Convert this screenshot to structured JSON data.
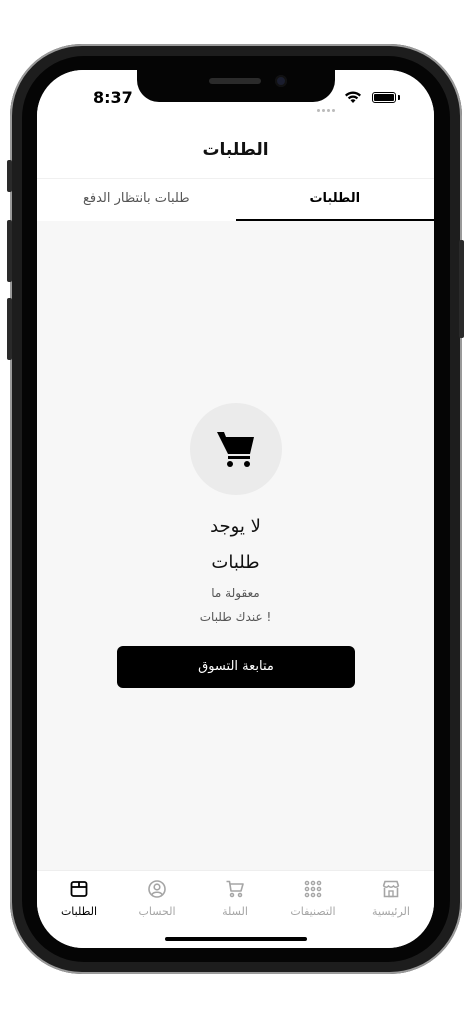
{
  "status_bar": {
    "time": "8:37"
  },
  "header": {
    "title": "الطلبات"
  },
  "tabs": [
    {
      "label": "طلبات بانتظار الدفع",
      "active": false
    },
    {
      "label": "الطلبات",
      "active": true
    }
  ],
  "empty_state": {
    "icon": "cart-icon",
    "title_line1": "لا يوجد",
    "title_line2": "طلبات",
    "subtitle_line1": "معقولة ما",
    "subtitle_line2": "عندك طلبات !",
    "button_label": "متابعة التسوق"
  },
  "bottom_nav": [
    {
      "label": "الطلبات",
      "icon": "box-icon",
      "active": true
    },
    {
      "label": "الحساب",
      "icon": "user-circle-icon",
      "active": false
    },
    {
      "label": "السلة",
      "icon": "cart-icon",
      "active": false
    },
    {
      "label": "التصنيفات",
      "icon": "grid-dots-icon",
      "active": false
    },
    {
      "label": "الرئيسية",
      "icon": "store-icon",
      "active": false
    }
  ],
  "colors": {
    "accent": "#000000",
    "inactive": "#a5a5a5",
    "background": "#f7f7f7"
  }
}
